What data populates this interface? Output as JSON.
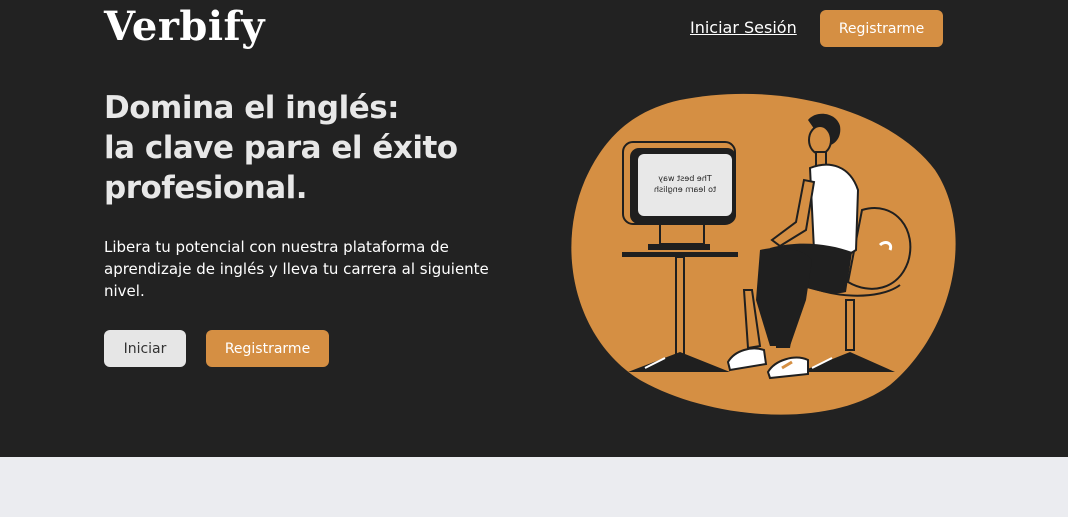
{
  "nav": {
    "logo": "Verbify",
    "login_label": "Iniciar Sesión",
    "register_label": "Registrarme"
  },
  "hero": {
    "headline_lines": [
      "Domina el inglés:",
      "la clave para el éxito",
      "profesional."
    ],
    "subtitle": "Libera tu potencial con nuestra plataforma de aprendizaje de inglés y lleva tu carrera al siguiente nivel.",
    "start_label": "Iniciar",
    "register_label": "Registrarme",
    "screen_text_lines": [
      "The best way",
      "to learn english"
    ]
  },
  "colors": {
    "background_dark": "#222222",
    "accent": "#d58f43",
    "light_button": "#e6e6e6",
    "page_bottom": "#ebecf0"
  }
}
